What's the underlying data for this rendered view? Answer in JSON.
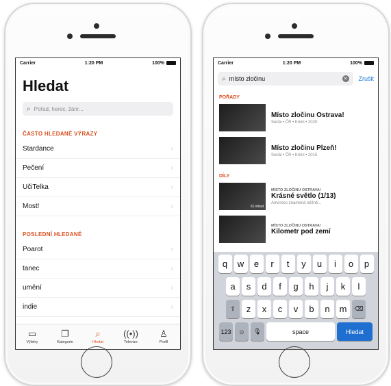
{
  "left": {
    "status": {
      "carrier": "Carrier",
      "time": "1:20 PM",
      "battery": "100%"
    },
    "title": "Hledat",
    "search_placeholder": "Pořad, herec, žánr...",
    "frequent_header": "ČASTO HLEDANÉ VÝRAZY",
    "frequent": [
      "Stardance",
      "Pečení",
      "UčiTelka",
      "Most!"
    ],
    "recent_header": "POSLEDNÍ HLEDANÉ",
    "recent": [
      "Poarot",
      "tanec",
      "umění",
      "indie"
    ],
    "tabs": [
      {
        "label": "Výběry",
        "icon": "display-icon"
      },
      {
        "label": "Kategorie",
        "icon": "cards-icon"
      },
      {
        "label": "Hledat",
        "icon": "search-icon"
      },
      {
        "label": "Televize",
        "icon": "broadcast-icon"
      },
      {
        "label": "Profil",
        "icon": "person-icon"
      }
    ]
  },
  "right": {
    "status": {
      "carrier": "Carrier",
      "time": "1:20 PM",
      "battery": "100%"
    },
    "search_value": "místo zločinu",
    "cancel": "Zrušit",
    "shows_header": "POŘADY",
    "shows": [
      {
        "title": "Místo zločinu Ostrava!",
        "meta": "Seriál • ČR • Krimi • 2020"
      },
      {
        "title": "Místo zločinu Plzeň!",
        "meta": "Seriál • ČR • Krimi • 2015"
      }
    ],
    "episodes_header": "DÍLY",
    "episodes": [
      {
        "series": "MÍSTO ZLOČINU OSTRAVA!",
        "title": "Krásné světlo (1/13)",
        "desc": "Amoroso znamená něžně...",
        "badge": "61 minut"
      },
      {
        "series": "MÍSTO ZLOČINU OSTRAVA!",
        "title": "Kilometr pod zemí",
        "desc": "",
        "badge": ""
      }
    ],
    "keyboard": {
      "row1": [
        "q",
        "w",
        "e",
        "r",
        "t",
        "y",
        "u",
        "i",
        "o",
        "p"
      ],
      "row2": [
        "a",
        "s",
        "d",
        "f",
        "g",
        "h",
        "j",
        "k",
        "l"
      ],
      "row3": [
        "z",
        "x",
        "c",
        "v",
        "b",
        "n",
        "m"
      ],
      "num": "123",
      "space": "space",
      "go": "Hledat"
    }
  },
  "colors": {
    "accent": "#d94f1e",
    "link": "#1d7ad8",
    "go_key": "#1f6fd0"
  }
}
